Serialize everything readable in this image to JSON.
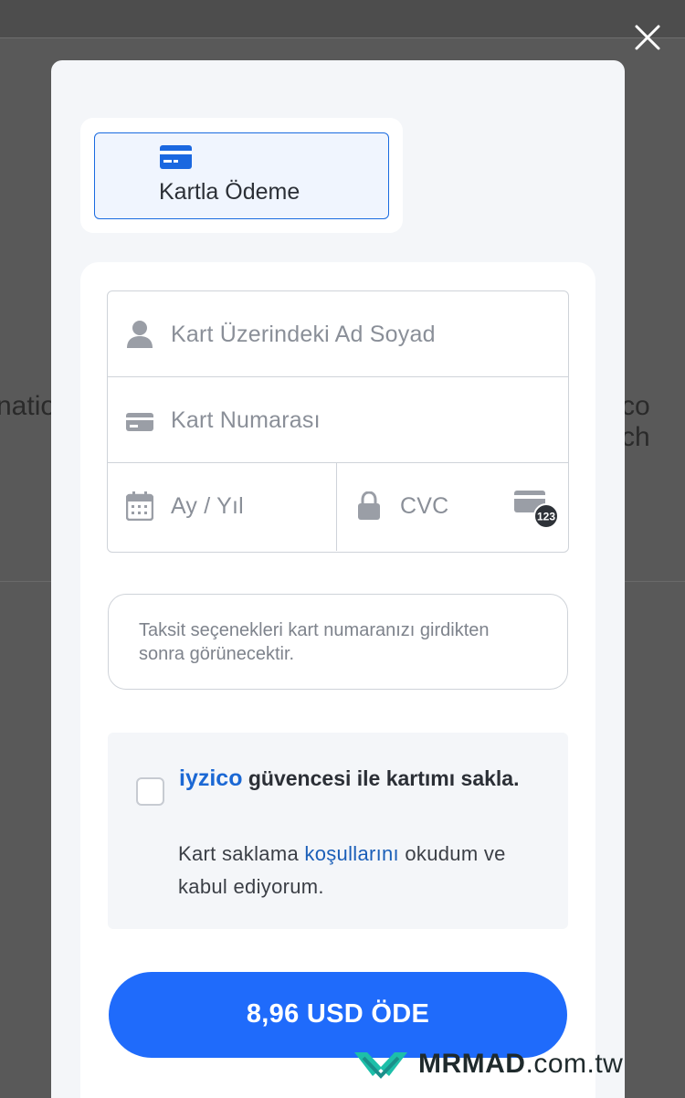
{
  "background": {
    "left_text": "natio",
    "right_text": "co ch"
  },
  "modal": {
    "tab": {
      "label": "Kartla Ödeme",
      "icon": "credit-card-icon"
    },
    "fields": {
      "name_placeholder": "Kart Üzerindeki Ad Soyad",
      "number_placeholder": "Kart Numarası",
      "expiry_placeholder": "Ay / Yıl",
      "cvc_placeholder": "CVC",
      "cvc_badge": "123"
    },
    "installment_note": "Taksit seçenekleri kart numaranızı girdikten sonra görünecektir.",
    "save_card": {
      "brand": "iyzico",
      "title_rest": " güvencesi ile kartımı sakla.",
      "terms_before": "Kart saklama ",
      "terms_link": "koşullarını",
      "terms_after": " okudum ve kabul ediyorum."
    },
    "pay_button": "8,96 USD ÖDE"
  },
  "watermark": {
    "brand": "MRMAD",
    "domain": ".com.tw"
  },
  "colors": {
    "accent": "#1f6bfb",
    "brand_text": "#1b68d4",
    "overlay": "#595959"
  }
}
